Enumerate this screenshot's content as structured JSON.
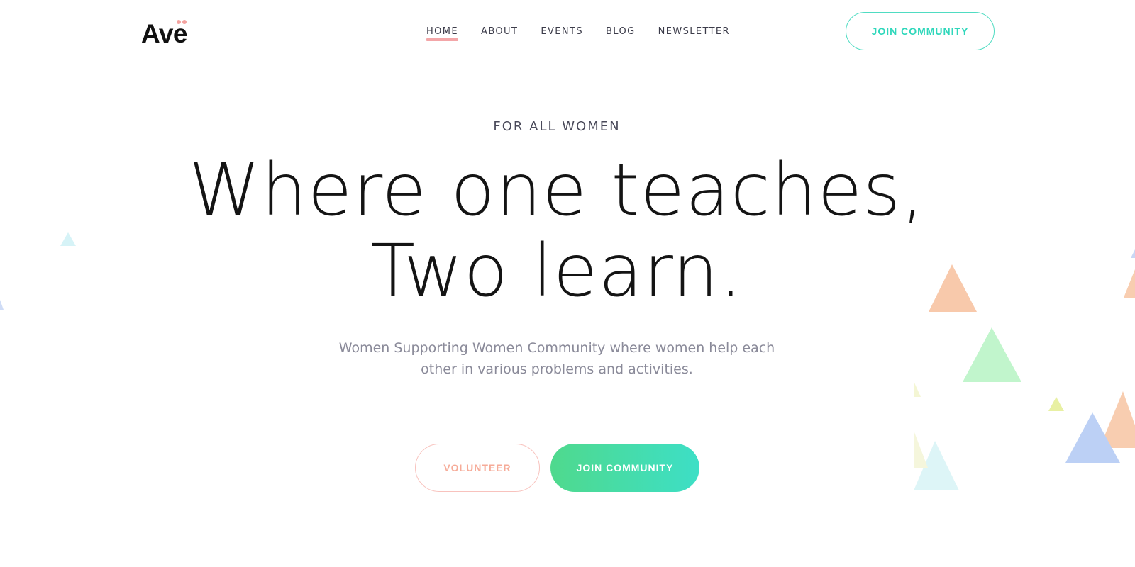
{
  "brand": {
    "logo_text": "Ave",
    "logo_dot_colors": [
      "#f4a3a0",
      "#f4a3a0"
    ]
  },
  "nav": {
    "items": [
      {
        "label": "HOME",
        "active": true
      },
      {
        "label": "ABOUT",
        "active": false
      },
      {
        "label": "EVENTS",
        "active": false
      },
      {
        "label": "BLOG",
        "active": false
      },
      {
        "label": "NEWSLETTER",
        "active": false
      }
    ],
    "active_underline_color": "#f3a6a8"
  },
  "header": {
    "cta_label": "JOIN COMMUNITY"
  },
  "hero": {
    "eyebrow": "FOR ALL WOMEN",
    "headline_line1": "Where one teaches,",
    "headline_line2": "Two learn.",
    "subtext_line1": "Women Supporting Women Community where women help each",
    "subtext_line2": "other in various problems and activities.",
    "volunteer_label": "VOLUNTEER",
    "join_label": "JOIN COMMUNITY"
  },
  "colors": {
    "accent_teal": "#2fd7bb",
    "accent_green": "#4fd98d",
    "accent_peach": "#f6ab98",
    "headline": "#141414",
    "muted_text": "#8a8a99"
  },
  "decoration": {
    "triangle_colors": [
      "#f6c7a9",
      "#bdf4cb",
      "#b9cdf3",
      "#e7ef9f",
      "#d6f3f7"
    ]
  }
}
